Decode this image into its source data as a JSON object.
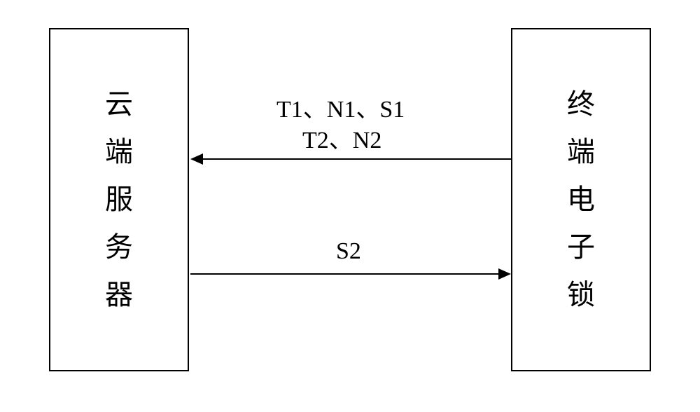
{
  "boxes": {
    "left": {
      "c1": "云",
      "c2": "端",
      "c3": "服",
      "c4": "务",
      "c5": "器"
    },
    "right": {
      "c1": "终",
      "c2": "端",
      "c3": "电",
      "c4": "子",
      "c5": "锁"
    }
  },
  "arrows": {
    "top": {
      "line1": "T1、N1、S1",
      "line2": "T2、N2"
    },
    "bottom": {
      "label": "S2"
    }
  }
}
